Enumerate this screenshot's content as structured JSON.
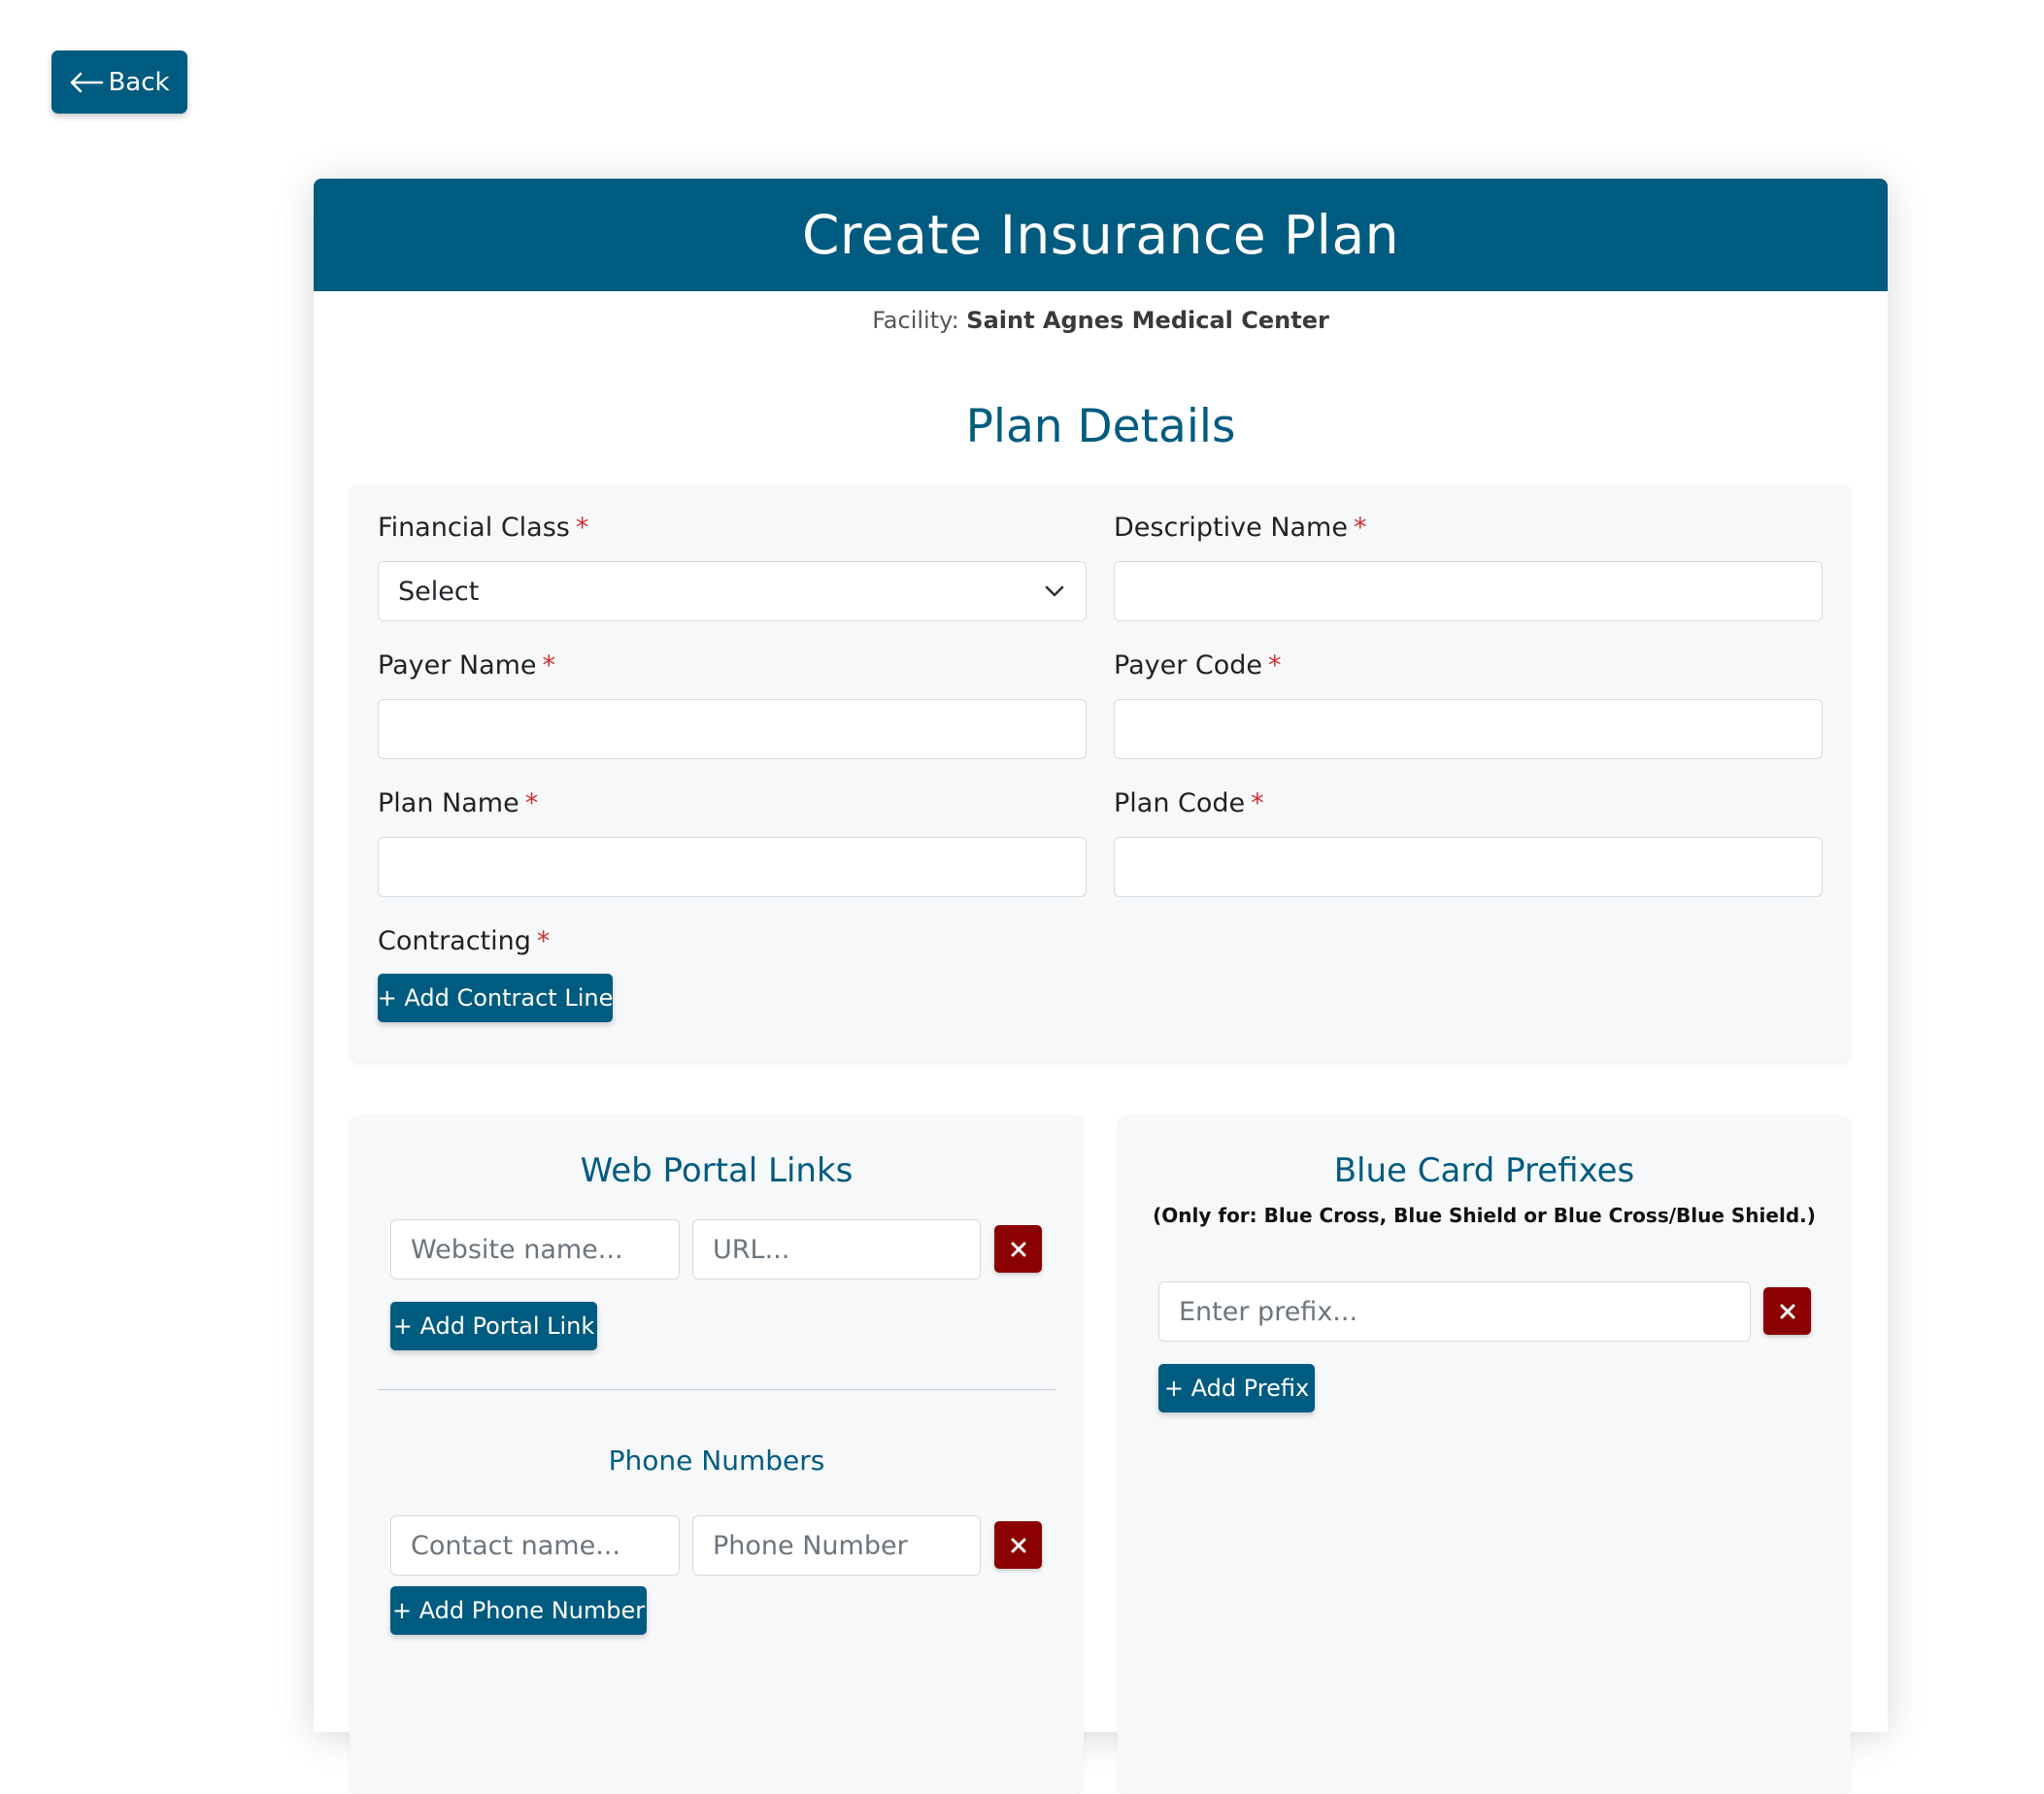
{
  "back_button": {
    "label": "Back",
    "icon": "arrow-left-icon"
  },
  "header": {
    "title": "Create Insurance Plan"
  },
  "facility": {
    "label": "Facility:",
    "name": "Saint Agnes Medical Center"
  },
  "plan_details": {
    "title": "Plan Details",
    "required_marker": "*",
    "financial_class": {
      "label": "Financial Class",
      "value": "Select"
    },
    "descriptive_name": {
      "label": "Descriptive Name",
      "value": ""
    },
    "payer_name": {
      "label": "Payer Name",
      "value": ""
    },
    "payer_code": {
      "label": "Payer Code",
      "value": ""
    },
    "plan_name": {
      "label": "Plan Name",
      "value": ""
    },
    "plan_code": {
      "label": "Plan Code",
      "value": ""
    },
    "contracting": {
      "label": "Contracting",
      "add_button": "+ Add Contract Line"
    }
  },
  "web_portal_links": {
    "title": "Web Portal Links",
    "website_placeholder": "Website name...",
    "url_placeholder": "URL...",
    "add_button": "+ Add Portal Link"
  },
  "phone_numbers": {
    "title": "Phone Numbers",
    "contact_placeholder": "Contact name...",
    "phone_placeholder": "Phone Number",
    "add_button": "+ Add Phone Number"
  },
  "blue_card_prefixes": {
    "title": "Blue Card Prefixes",
    "note": "(Only for: Blue Cross, Blue Shield or Blue Cross/Blue Shield.)",
    "prefix_placeholder": "Enter prefix...",
    "add_button": "+ Add Prefix"
  },
  "colors": {
    "primary": "#005b80",
    "danger": "#8b0000",
    "required": "#d32f2f",
    "panel_bg": "#f6f8fa"
  }
}
